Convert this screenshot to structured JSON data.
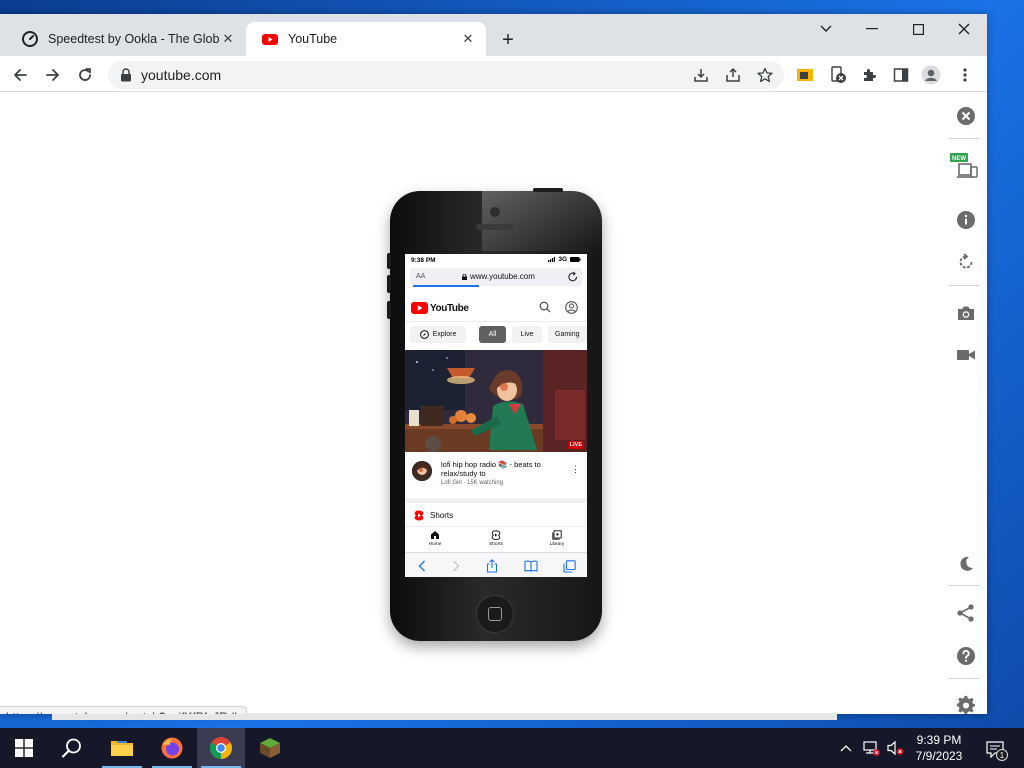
{
  "browser": {
    "tabs": [
      {
        "title": "Speedtest by Ookla - The Global",
        "favicon": "speedtest-icon",
        "active": false
      },
      {
        "title": "YouTube",
        "favicon": "youtube-icon",
        "active": true
      }
    ],
    "address": "youtube.com",
    "status_url": "https://m.youtube.com/watch?v=jfKfPfyJRdk"
  },
  "phone": {
    "status_time": "9:38 PM",
    "network": "3G",
    "safari_text_size": "AA",
    "safari_url": "www.youtube.com",
    "yt_logo_text": "YouTube",
    "chips": [
      "Explore",
      "All",
      "Live",
      "Gaming"
    ],
    "active_chip": "All",
    "live_badge": "LIVE",
    "video_title": "lofi hip hop radio 📚 - beats to relax/study to",
    "video_channel": "Lofi Girl · 15K watching",
    "shorts_label": "Shorts",
    "bottom_nav": [
      "Home",
      "Shorts",
      "Library"
    ]
  },
  "taskbar": {
    "time": "9:39 PM",
    "date": "7/9/2023",
    "notification_count": "1"
  },
  "colors": {
    "youtube_red": "#ff0000",
    "safari_blue": "#1e73e8",
    "taskbar": "#16182a"
  }
}
